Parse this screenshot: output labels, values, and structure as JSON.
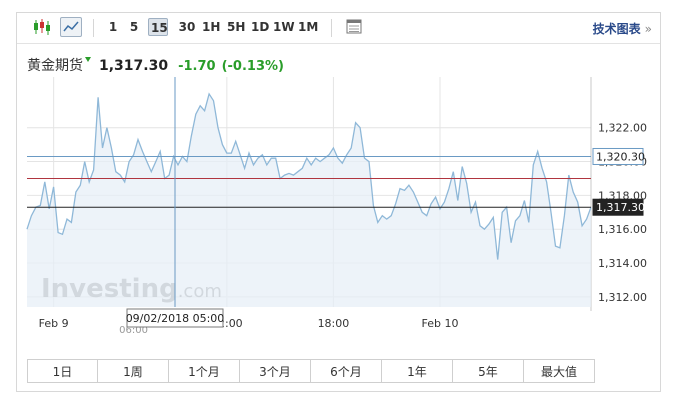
{
  "toolbar": {
    "intervals": [
      "1",
      "5",
      "15",
      "30",
      "1H",
      "5H",
      "1D",
      "1W",
      "1M"
    ],
    "selected_interval": "15",
    "advanced_chart_label": "技术图表",
    "advanced_chevron": "»"
  },
  "quote": {
    "name": "黄金期货",
    "price": "1,317.30",
    "change": "-1.70",
    "change_pct": "(-0.13%)"
  },
  "watermark": {
    "brand": "Investing",
    "suffix": ".com"
  },
  "crosshair": {
    "label": "09/02/2018 05:00",
    "hidden_tick": "06:00"
  },
  "periods": [
    "1日",
    "1周",
    "1个月",
    "3个月",
    "6个月",
    "1年",
    "5年",
    "最大值"
  ],
  "colors": {
    "line": "#8fb8d8",
    "area": "#e7eff7",
    "blue_level": "#6a9ac4",
    "red_level": "#b0353f",
    "black_level": "#222222",
    "up": "#2a9d2a",
    "grid": "#e4e4e4"
  },
  "chart_data": {
    "type": "area",
    "ylim": [
      1311.4,
      1325.0
    ],
    "yticks": [
      1312,
      1314,
      1316,
      1318,
      1320,
      1322
    ],
    "ytick_labels": [
      "1,312.00",
      "1,314.00",
      "1,316.00",
      "1,318.00",
      "1,320.00",
      "1,322.00"
    ],
    "xticks": [
      {
        "label": "Feb 9",
        "index": 6
      },
      {
        "label": "12:00",
        "index": 45
      },
      {
        "label": "18:00",
        "index": 69
      },
      {
        "label": "Feb 10",
        "index": 93
      }
    ],
    "levels": [
      {
        "name": "blue",
        "value": 1320.3,
        "label": "1,320.30"
      },
      {
        "name": "red",
        "value": 1319.0,
        "label": ""
      },
      {
        "name": "black",
        "value": 1317.3,
        "label": "1,317.30"
      }
    ],
    "series": [
      {
        "values": [
          1316.0,
          1316.8,
          1317.3,
          1317.4,
          1318.8,
          1317.2,
          1318.5,
          1315.8,
          1315.7,
          1316.6,
          1316.4,
          1318.2,
          1318.6,
          1320.0,
          1318.8,
          1319.5,
          1323.8,
          1320.8,
          1322.0,
          1320.8,
          1319.4,
          1319.2,
          1318.8,
          1320.0,
          1320.4,
          1321.3,
          1320.6,
          1320.0,
          1319.4,
          1320.0,
          1320.6,
          1319.0,
          1319.2,
          1320.3,
          1319.8,
          1320.3,
          1320.0,
          1321.5,
          1322.8,
          1323.3,
          1323.0,
          1324.0,
          1323.6,
          1322.0,
          1321.0,
          1320.5,
          1320.5,
          1321.2,
          1320.4,
          1319.6,
          1320.5,
          1319.8,
          1320.2,
          1320.4,
          1319.8,
          1320.2,
          1320.2,
          1319.0,
          1319.2,
          1319.3,
          1319.2,
          1319.4,
          1319.6,
          1320.2,
          1319.8,
          1320.2,
          1320.0,
          1320.2,
          1320.4,
          1320.8,
          1320.2,
          1319.9,
          1320.4,
          1320.8,
          1322.3,
          1322.0,
          1320.2,
          1320.0,
          1317.4,
          1316.4,
          1316.8,
          1316.6,
          1316.8,
          1317.5,
          1318.4,
          1318.3,
          1318.6,
          1318.2,
          1317.6,
          1317.0,
          1316.8,
          1317.5,
          1317.9,
          1317.2,
          1317.6,
          1318.4,
          1319.4,
          1317.7,
          1319.7,
          1318.7,
          1317.0,
          1317.6,
          1316.2,
          1316.0,
          1316.3,
          1316.7,
          1314.2,
          1317.0,
          1317.3,
          1315.2,
          1316.5,
          1316.8,
          1317.7,
          1316.4,
          1319.8,
          1320.6,
          1319.6,
          1318.8,
          1317.0,
          1315.0,
          1314.9,
          1316.8,
          1319.2,
          1318.2,
          1317.6,
          1316.2,
          1316.6,
          1317.3
        ]
      }
    ]
  }
}
